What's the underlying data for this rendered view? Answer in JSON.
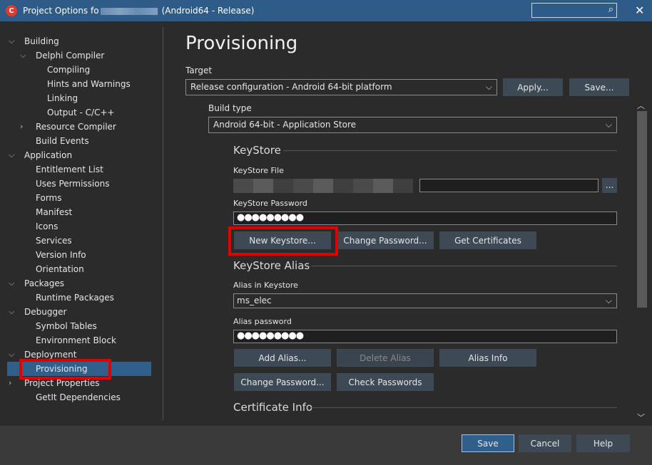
{
  "window": {
    "title_prefix": "Project Options fo",
    "title_suffix": "(Android64 - Release)",
    "search_placeholder": "",
    "icons": {
      "app": "delphi-app-icon",
      "search": "search-icon",
      "close": "close-icon"
    }
  },
  "tree": [
    {
      "label": "Building",
      "level": 0,
      "chevron": "down"
    },
    {
      "label": "Delphi Compiler",
      "level": 1,
      "chevron": "down"
    },
    {
      "label": "Compiling",
      "level": 2,
      "chevron": ""
    },
    {
      "label": "Hints and Warnings",
      "level": 2,
      "chevron": ""
    },
    {
      "label": "Linking",
      "level": 2,
      "chevron": ""
    },
    {
      "label": "Output - C/C++",
      "level": 2,
      "chevron": ""
    },
    {
      "label": "Resource Compiler",
      "level": 1,
      "chevron": "right"
    },
    {
      "label": "Build Events",
      "level": 1,
      "chevron": ""
    },
    {
      "label": "Application",
      "level": 0,
      "chevron": "down"
    },
    {
      "label": "Entitlement List",
      "level": 1,
      "chevron": ""
    },
    {
      "label": "Uses Permissions",
      "level": 1,
      "chevron": ""
    },
    {
      "label": "Forms",
      "level": 1,
      "chevron": ""
    },
    {
      "label": "Manifest",
      "level": 1,
      "chevron": ""
    },
    {
      "label": "Icons",
      "level": 1,
      "chevron": ""
    },
    {
      "label": "Services",
      "level": 1,
      "chevron": ""
    },
    {
      "label": "Version Info",
      "level": 1,
      "chevron": ""
    },
    {
      "label": "Orientation",
      "level": 1,
      "chevron": ""
    },
    {
      "label": "Packages",
      "level": 0,
      "chevron": "down"
    },
    {
      "label": "Runtime Packages",
      "level": 1,
      "chevron": ""
    },
    {
      "label": "Debugger",
      "level": 0,
      "chevron": "down"
    },
    {
      "label": "Symbol Tables",
      "level": 1,
      "chevron": ""
    },
    {
      "label": "Environment Block",
      "level": 1,
      "chevron": ""
    },
    {
      "label": "Deployment",
      "level": 0,
      "chevron": "down"
    },
    {
      "label": "Provisioning",
      "level": 1,
      "chevron": "",
      "selected": true
    },
    {
      "label": "Project Properties",
      "level": 0,
      "chevron": "right"
    },
    {
      "label": "GetIt Dependencies",
      "level": 1,
      "chevron": ""
    }
  ],
  "main": {
    "title": "Provisioning",
    "target_label": "Target",
    "target_value": "Release configuration - Android 64-bit platform",
    "apply_label": "Apply...",
    "save_target_label": "Save...",
    "build_type_label": "Build type",
    "build_type_value": "Android 64-bit - Application Store",
    "keystore_section": "KeyStore",
    "keystore_file_label": "KeyStore File",
    "browse_label": "...",
    "keystore_password_label": "KeyStore Password",
    "keystore_password_value": "●●●●●●●●●",
    "new_keystore_label": "New Keystore...",
    "change_password_label": "Change Password...",
    "get_certificates_label": "Get Certificates",
    "alias_section": "KeyStore Alias",
    "alias_label": "Alias in Keystore",
    "alias_value": "ms_elec",
    "alias_password_label": "Alias password",
    "alias_password_value": "●●●●●●●●●",
    "add_alias_label": "Add Alias...",
    "delete_alias_label": "Delete Alias",
    "alias_info_label": "Alias Info",
    "alias_change_password_label": "Change Password...",
    "check_passwords_label": "Check Passwords",
    "certificate_section": "Certificate Info"
  },
  "footer": {
    "save_label": "Save",
    "cancel_label": "Cancel",
    "help_label": "Help"
  },
  "colors": {
    "titlebar": "#2e5b87",
    "selection": "#2f5f8a",
    "highlight": "#e00000"
  }
}
